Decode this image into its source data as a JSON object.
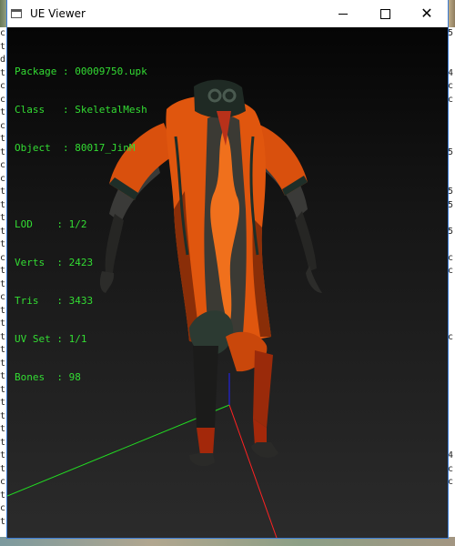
{
  "window": {
    "title": "UE Viewer",
    "icon": "window-app-icon"
  },
  "info": {
    "package_label": "Package : ",
    "package": "00009750.upk",
    "class_label": "Class   : ",
    "class": "SkeletalMesh",
    "object_label": "Object  : ",
    "object": "80017_JinM",
    "lod_label": "LOD    : ",
    "lod": "1/2",
    "verts_label": "Verts  : ",
    "verts": "2423",
    "tris_label": "Tris   : ",
    "tris": "3433",
    "uvset_label": "UV Set : ",
    "uvset": "1/1",
    "bones_label": "Bones  : ",
    "bones": "98"
  },
  "colors": {
    "overlay_text": "#33dd33",
    "axis_x": "#ff2222",
    "axis_y": "#22dd22",
    "axis_z": "#2222ff",
    "robe": "#e0560e"
  },
  "background": {
    "left_chars": [
      "c",
      "t",
      "d",
      "t",
      "c",
      "c",
      "t",
      "c",
      "t",
      "t",
      "c",
      "c",
      "t",
      "t",
      "t",
      "t",
      "t",
      "c",
      "t",
      "t",
      "c",
      "t",
      "t",
      "t",
      "t",
      "t",
      "t",
      "t",
      "t",
      "t",
      "t",
      "t",
      "t",
      "t",
      "c",
      "t",
      "c",
      "t"
    ],
    "right_chars": [
      "5",
      "",
      "",
      "4",
      "c",
      "c",
      "",
      "",
      "",
      "5",
      "",
      "",
      "5",
      "5",
      "",
      "5",
      "",
      "c",
      "c",
      "",
      "",
      "",
      "",
      "c",
      "",
      "",
      "",
      "",
      "",
      "",
      "",
      "",
      "4",
      "c",
      "c",
      ""
    ]
  }
}
